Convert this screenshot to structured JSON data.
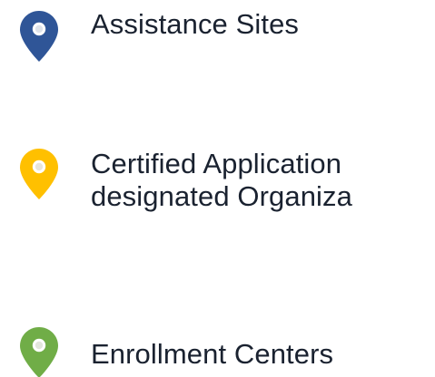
{
  "legend": {
    "items": [
      {
        "label": "Assistance Sites",
        "icon": "map-pin-icon",
        "color": "#2f5597"
      },
      {
        "label_line1": "Certified Application",
        "label_line2": "designated Organiza",
        "icon": "map-pin-icon",
        "color": "#ffc000"
      },
      {
        "label": "Enrollment Centers",
        "icon": "map-pin-icon",
        "color": "#70ad47"
      }
    ]
  }
}
